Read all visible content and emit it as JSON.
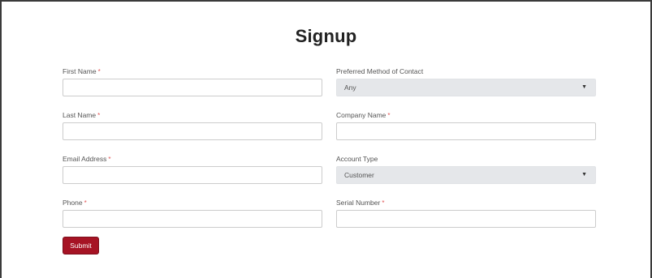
{
  "page": {
    "title": "Signup"
  },
  "form": {
    "left_fields": [
      {
        "label": "First Name",
        "required_mark": "*",
        "value": ""
      },
      {
        "label": "Last Name",
        "required_mark": "*",
        "value": ""
      },
      {
        "label": "Email Address",
        "required_mark": "*",
        "value": ""
      },
      {
        "label": "Phone",
        "required_mark": "*",
        "value": ""
      }
    ],
    "right_fields": {
      "contact_method": {
        "label": "Preferred Method of Contact",
        "selected": "Any"
      },
      "company_name": {
        "label": "Company Name",
        "required_mark": "*",
        "value": ""
      },
      "account_type": {
        "label": "Account Type",
        "selected": "Customer"
      },
      "serial_number": {
        "label": "Serial Number",
        "required_mark": "*",
        "value": ""
      }
    },
    "select_caret": "▼",
    "submit_label": "Submit"
  },
  "colors": {
    "submit_bg": "#a61324",
    "required_mark": "#e25555",
    "select_bg": "#e5e7ea"
  }
}
